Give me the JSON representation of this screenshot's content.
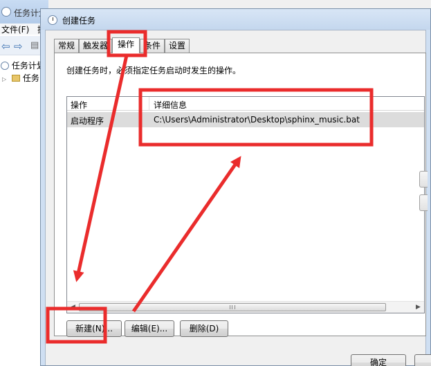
{
  "background_window": {
    "title": "任务计划",
    "menu": [
      "文件(F)",
      "操"
    ],
    "tree": [
      "任务计划",
      "任务"
    ]
  },
  "dialog": {
    "title": "创建任务",
    "tabs": [
      "常规",
      "触发器",
      "操作",
      "条件",
      "设置"
    ],
    "active_tab": "操作",
    "description": "创建任务时，必须指定任务启动时发生的操作。",
    "list": {
      "columns": [
        "操作",
        "详细信息"
      ],
      "rows": [
        {
          "action": "启动程序",
          "details": "C:\\Users\\Administrator\\Desktop\\sphinx_music.bat"
        }
      ]
    },
    "buttons": {
      "new": "新建(N)...",
      "edit": "编辑(E)...",
      "delete": "删除(D)",
      "ok": "确定"
    }
  },
  "colors": {
    "annotation_red": "#ea2c2c",
    "selected_row": "#dcdcdc"
  }
}
